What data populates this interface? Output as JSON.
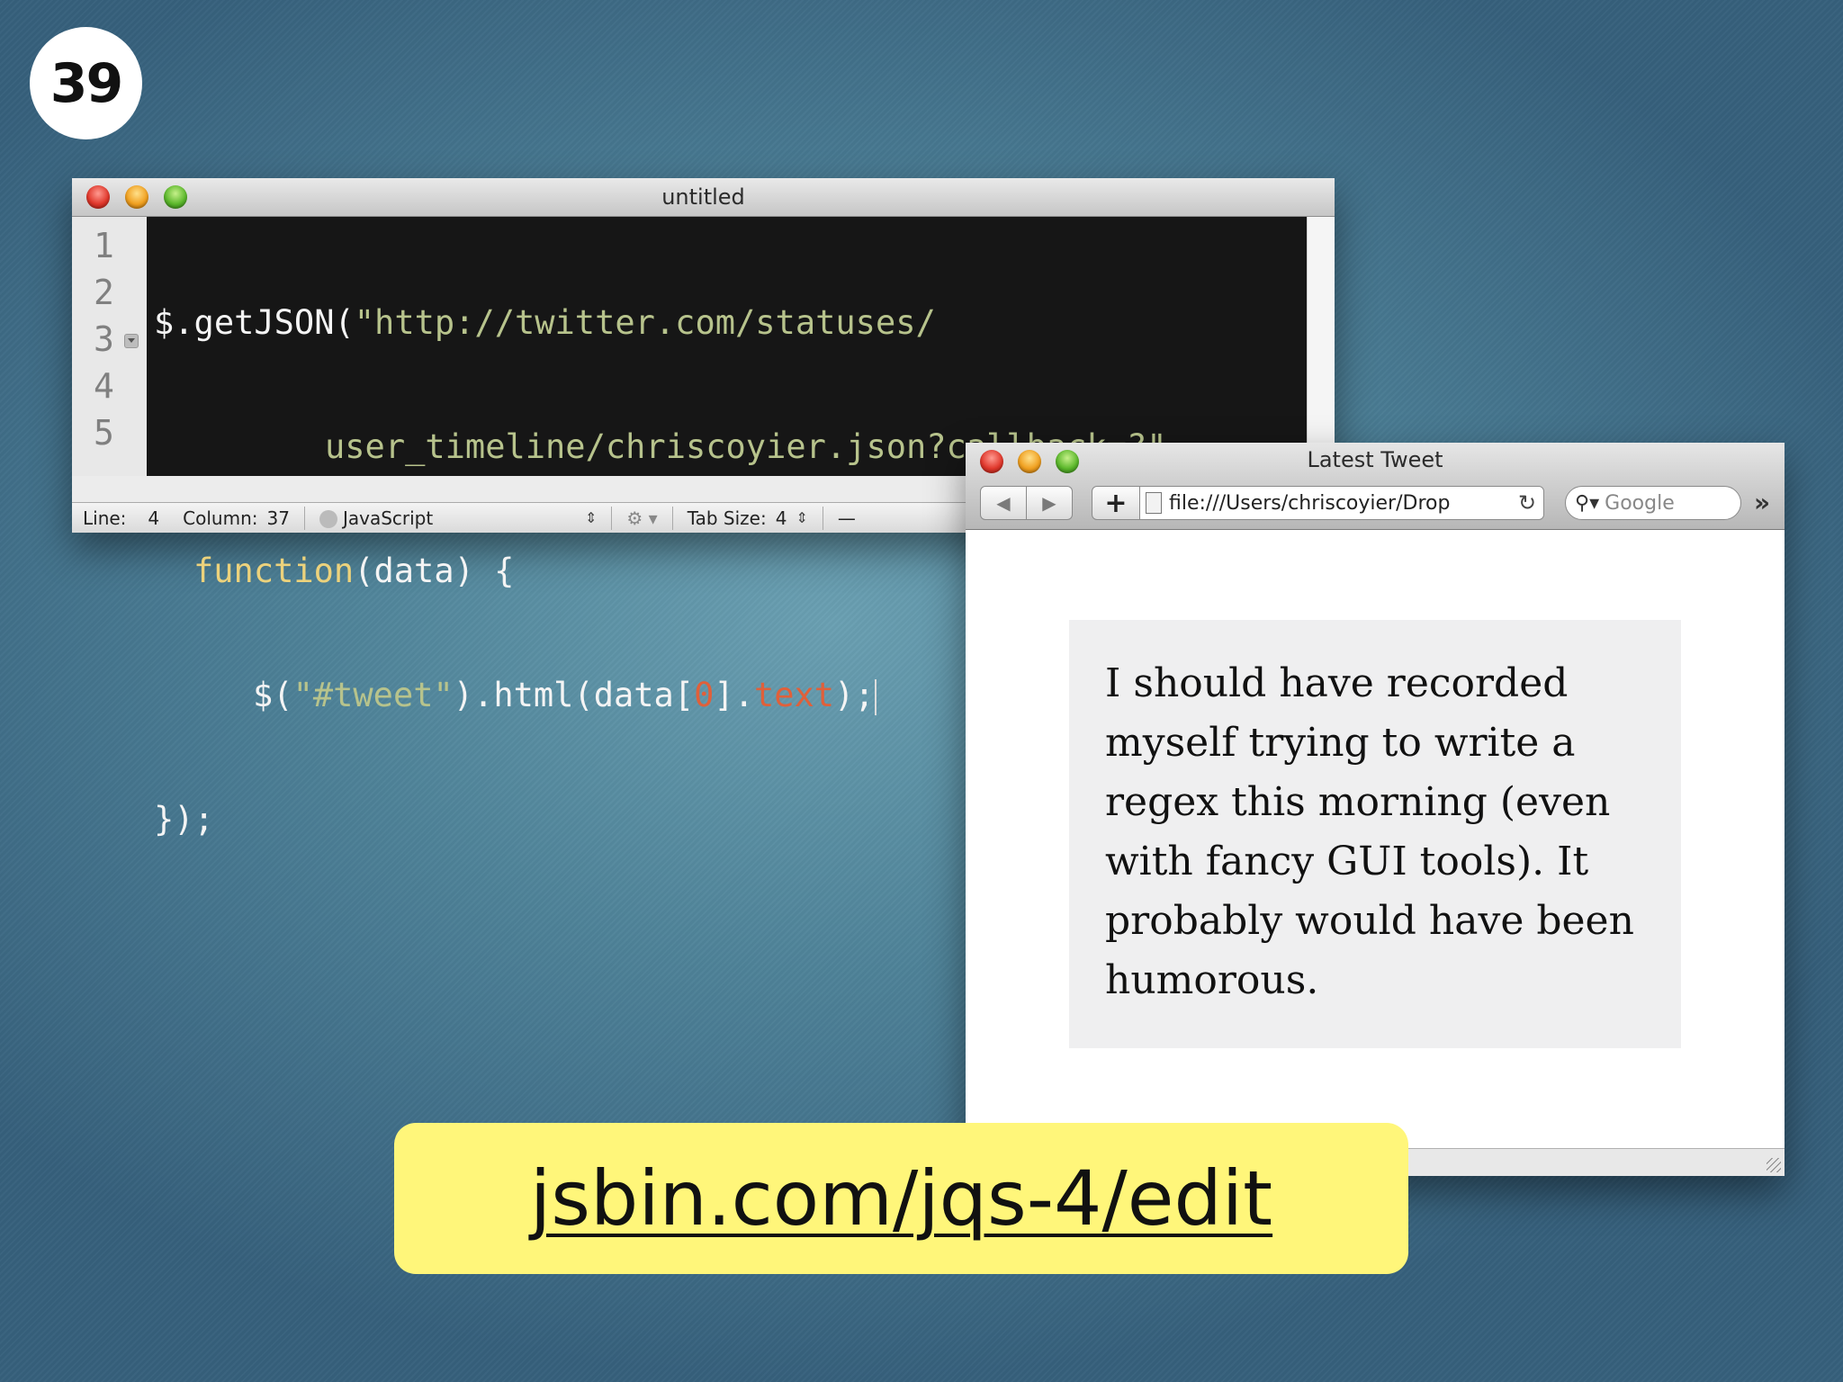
{
  "slide": {
    "number": "39"
  },
  "editor": {
    "title": "untitled",
    "line_numbers": [
      "1",
      "2",
      "3",
      "4",
      "5"
    ],
    "code": {
      "l1_a": "$.getJSON(",
      "l1_b": "\"http://twitter.com/statuses/",
      "l2": "user_timeline/chriscoyier.json?callback=?\"",
      "l2_end": ",",
      "l3_a": "function",
      "l3_b": "(data) {",
      "l4_a": "$(",
      "l4_b": "\"#tweet\"",
      "l4_c": ").html(data[",
      "l4_d": "0",
      "l4_e": "].",
      "l4_f": "text",
      "l4_g": ");",
      "l5": "});"
    },
    "status": {
      "line_label": "Line:",
      "line_value": "4",
      "column_label": "Column:",
      "column_value": "37",
      "language": "JavaScript",
      "tab_label": "Tab Size:",
      "tab_value": "4",
      "dash": "—"
    }
  },
  "browser": {
    "title": "Latest Tweet",
    "url": "file:///Users/chriscoyier/Drop",
    "search_placeholder": "Google",
    "tweet": "I should have recorded myself trying to write a regex this morning (even with fancy GUI tools). It probably would have been humorous."
  },
  "link": {
    "text": "jsbin.com/jqs-4/edit"
  },
  "colors": {
    "code_bg": "#161616",
    "string": "#b7c38c",
    "keyword": "#ecd27c",
    "number": "#e0603a",
    "banner": "#fff67a"
  }
}
